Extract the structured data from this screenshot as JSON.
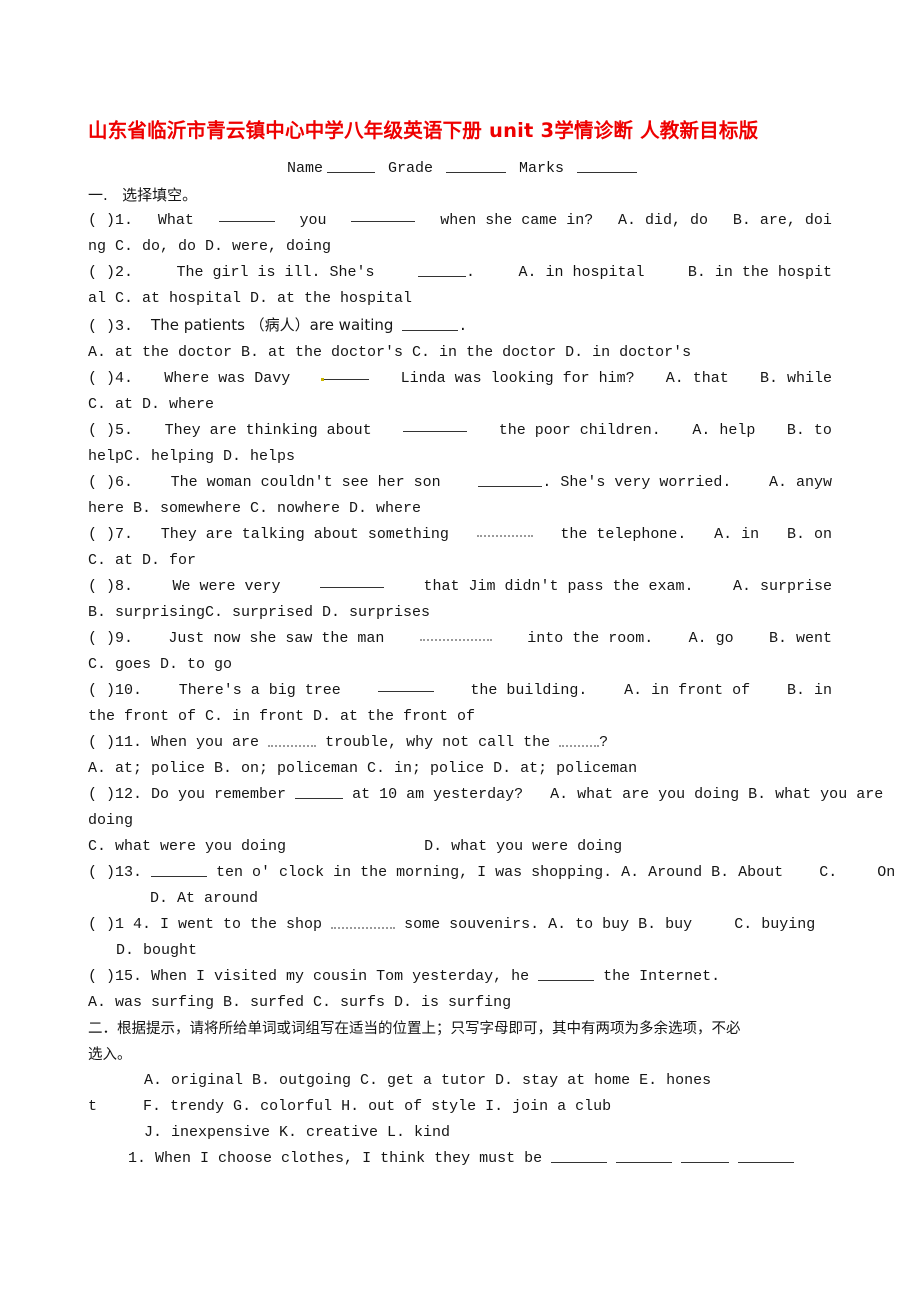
{
  "document": {
    "title": "山东省临沂市青云镇中心中学八年级英语下册 unit 3学情诊断 人教新目标版",
    "title_color": "#ee0000",
    "header_fields": {
      "name_label": "Name",
      "grade_label": "Grade",
      "marks_label": "Marks"
    }
  },
  "section_one": {
    "heading_num": "一.",
    "heading_text": "选择填空。",
    "questions": [
      {
        "marker": "(   )1.",
        "stem_a": "What",
        "stem_b": "you",
        "stem_c": "when she came in?",
        "opt_a": "A. did, do",
        "opt_b": "B. are, doi",
        "cont": "ng C. do, do    D. were, doing"
      },
      {
        "marker": "(   )2.",
        "stem": "The girl is ill. She's",
        "tail": ".",
        "opt_a": "A. in hospital",
        "opt_b": "B. in the hospit",
        "cont": "al C. at hospital    D. at the hospital"
      },
      {
        "marker": "(   )3.",
        "stem": "The patients （病人）are waiting",
        "tail": ".",
        "opts_line": "A. at the doctor    B. at the doctor's C. in the doctor    D. in doctor's"
      },
      {
        "marker": "(   )4.",
        "stem_a": "Where was Davy",
        "stem_b": "Linda was looking for him?",
        "opt_a": "A. that",
        "opt_b": "B. while",
        "cont": "C. at    D. where"
      },
      {
        "marker": "(   )5.",
        "stem_a": "They are thinking about",
        "stem_b": "the poor children.",
        "opt_a": "A. help",
        "opt_b": "B. to",
        "cont": "helpC. helping   D. helps"
      },
      {
        "marker": "(   )6.",
        "stem_a": "The woman couldn't see her son",
        "stem_b": ". She's very worried.",
        "opt_a": "A. anyw",
        "cont": "here    B. somewhere   C. nowhere     D. where"
      },
      {
        "marker": "(   )7.",
        "stem_a": "They are talking about something",
        "stem_b": "the telephone.",
        "opt_a": "A. in",
        "opt_b": "B. on",
        "cont": "C. at    D. for"
      },
      {
        "marker": "(   )8.",
        "stem_a": "We were very",
        "stem_b": "that Jim didn't pass the exam.",
        "opt_a": "A. surprise",
        "cont": "  B. surprisingC. surprised   D. surprises"
      },
      {
        "marker": "(   )9.",
        "stem_a": "Just now she saw the man",
        "stem_b": "into the room.",
        "opt_a": "A. go",
        "opt_b": "B. went",
        "cont": "C. goes    D. to go"
      },
      {
        "marker": "(   )10.",
        "stem_a": "There's a big tree",
        "stem_b": "the building.",
        "opt_a": "A. in front of",
        "opt_b": "B. in",
        "cont": "the front of C. in front     D. at the front of"
      },
      {
        "marker": "(   )11.",
        "stem_a": "When you are",
        "stem_b": "trouble, why not call the",
        "tail": "?",
        "opts_line": "A. at; police      B. on; policeman     C. in; police      D. at; policeman"
      },
      {
        "marker": "(   )12.",
        "stem_a": "Do you remember",
        "stem_b": "at 10 am yesterday?",
        "opt_a": "A. what are you doing B. what you are",
        "cont": "doing",
        "opts_line2_c": "C. what were you doing",
        "opts_line2_d": "D. what you were doing"
      },
      {
        "marker": "(   )13.",
        "stem_b": "ten o' clock in the morning, I was shopping.",
        "opt_a": "A. Around",
        "opt_b": "B. About",
        "opt_c": "C.",
        "opt_c2": "On",
        "cont": "D. At around"
      },
      {
        "marker": "(   )1 4.",
        "stem_a": "I went to the shop",
        "stem_b": "some souvenirs.",
        "opt_a": "A. to buy",
        "opt_b": "B. buy",
        "opt_c": "C. buying",
        "cont": "D. bought"
      },
      {
        "marker": "(   )15.",
        "stem_a": "When I visited my cousin Tom yesterday, he",
        "stem_b": "the Internet.",
        "opts_line": "A. was surfing  B. surfed          C. surfs            D. is surfing"
      }
    ]
  },
  "section_two": {
    "heading_line1": "二．根据提示，请将所给单词或词组写在适当的位置上；只写字母即可，其中有两项为多余选项，不必",
    "heading_line2": "选入。",
    "word_bank_line1": "A. original    B. outgoing    C. get a tutor    D. stay at home E. hones",
    "word_bank_line2_lead": "t",
    "word_bank_line2": "F. trendy G. colorful    H. out of style    I. join a club",
    "word_bank_line3": "J. inexpensive    K. creative    L. kind",
    "item1_num": "1.",
    "item1_text": "When I choose clothes, I think they must be"
  }
}
